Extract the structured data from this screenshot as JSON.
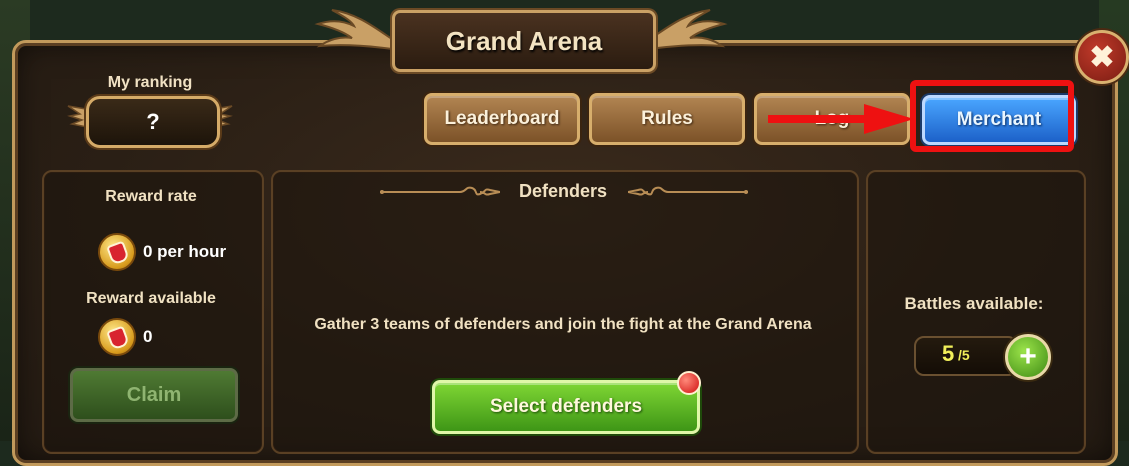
{
  "title": "Grand Arena",
  "ranking": {
    "label": "My ranking",
    "value": "?"
  },
  "nav_buttons": {
    "leaderboard": "Leaderboard",
    "rules": "Rules",
    "log": "Log",
    "merchant": "Merchant"
  },
  "left_panel": {
    "reward_rate_label": "Reward rate",
    "reward_rate_value": "0 per hour",
    "reward_available_label": "Reward available",
    "reward_available_value": "0",
    "claim_label": "Claim"
  },
  "center_panel": {
    "heading": "Defenders",
    "message": "Gather 3 teams of defenders and join the fight at the Grand Arena",
    "select_label": "Select defenders"
  },
  "right_panel": {
    "battles_label": "Battles available:",
    "battles_current": "5",
    "battles_max": "/5"
  },
  "colors": {
    "frame_gold": "#c29a5c",
    "highlight_red": "#ee1111",
    "merchant_blue": "#2f86ea",
    "select_green": "#5cb526"
  },
  "icons": [
    "close-icon",
    "coin-icon",
    "plus-icon",
    "red-arrow-annotation"
  ]
}
